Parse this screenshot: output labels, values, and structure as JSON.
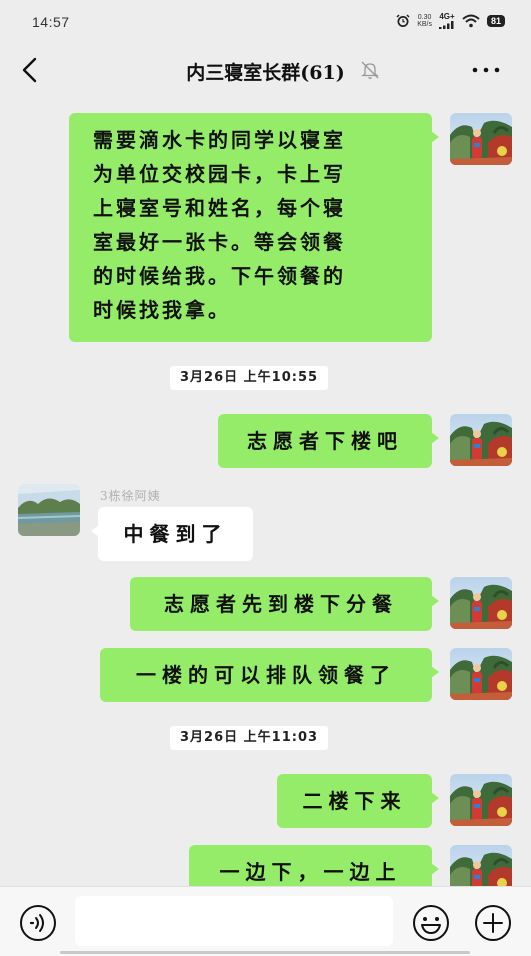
{
  "status_bar": {
    "time": "14:57",
    "net_speed_value": "0.30",
    "net_speed_unit": "KB/s",
    "signal_label": "4G+",
    "battery": "81"
  },
  "header": {
    "title": "内三寝室长群(61)"
  },
  "messages": [
    {
      "sender": "me",
      "lines": [
        "需要滴水卡的同学以寝室",
        "为单位交校园卡，卡上写",
        "上寝室号和姓名，每个寝",
        "室最好一张卡。等会领餐",
        "的时候给我。下午领餐的",
        "时候找我拿。"
      ]
    },
    {
      "timestamp": "3月26日 上午10:55"
    },
    {
      "sender": "me",
      "text": "志愿者下楼吧"
    },
    {
      "sender": "other",
      "name": "3栋徐阿姨",
      "text": "中餐到了"
    },
    {
      "sender": "me",
      "text": "志愿者先到楼下分餐"
    },
    {
      "sender": "me",
      "text": "一楼的可以排队领餐了"
    },
    {
      "timestamp": "3月26日 上午11:03"
    },
    {
      "sender": "me",
      "text": "二楼下来"
    },
    {
      "sender": "me",
      "text": "一边下，一边上"
    }
  ],
  "input": {
    "value": "",
    "placeholder": ""
  },
  "colors": {
    "my_bubble": "#95ec69",
    "other_bubble": "#ffffff",
    "background": "#ededed"
  },
  "icons": [
    "back-icon",
    "mute-icon",
    "more-icon",
    "voice-icon",
    "emoji-icon",
    "plus-icon",
    "alarm-icon",
    "signal-icon",
    "wifi-icon",
    "battery-icon"
  ]
}
